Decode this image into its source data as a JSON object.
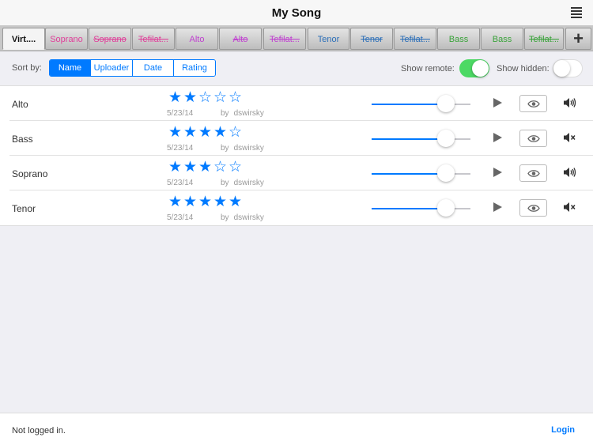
{
  "header": {
    "title": "My Song",
    "menu_icon": "list-menu-icon"
  },
  "tabs": [
    {
      "label": "Virt....",
      "color": "#111111",
      "struck": false,
      "active": true
    },
    {
      "label": "Soprano",
      "color": "#e0409a",
      "struck": false,
      "active": false
    },
    {
      "label": "Soprano",
      "color": "#e0409a",
      "struck": true,
      "active": false
    },
    {
      "label": "Tefilat...",
      "color": "#e0409a",
      "struck": true,
      "active": false
    },
    {
      "label": "Alto",
      "color": "#c040d0",
      "struck": false,
      "active": false
    },
    {
      "label": "Alto",
      "color": "#c040d0",
      "struck": true,
      "active": false
    },
    {
      "label": "Tefilat...",
      "color": "#c040d0",
      "struck": true,
      "active": false
    },
    {
      "label": "Tenor",
      "color": "#2c6fb8",
      "struck": false,
      "active": false
    },
    {
      "label": "Tenor",
      "color": "#2c6fb8",
      "struck": true,
      "active": false
    },
    {
      "label": "Tefilat...",
      "color": "#2c6fb8",
      "struck": true,
      "active": false
    },
    {
      "label": "Bass",
      "color": "#3aa33a",
      "struck": false,
      "active": false
    },
    {
      "label": "Bass",
      "color": "#3aa33a",
      "struck": false,
      "active": false
    },
    {
      "label": "Tefilat...",
      "color": "#3aa33a",
      "struck": true,
      "active": false
    }
  ],
  "add_tab_label": "+",
  "controls": {
    "sort_label": "Sort by:",
    "sort_options": [
      "Name",
      "Uploader",
      "Date",
      "Rating"
    ],
    "sort_selected": "Name",
    "show_remote_label": "Show remote:",
    "show_remote": true,
    "show_hidden_label": "Show hidden:",
    "show_hidden": false
  },
  "tracks": [
    {
      "name": "Alto",
      "rating": 2,
      "date": "5/23/14",
      "by_label": "by",
      "uploader": "dswirsky",
      "volume": 0.75,
      "muted": false
    },
    {
      "name": "Bass",
      "rating": 4,
      "date": "5/23/14",
      "by_label": "by",
      "uploader": "dswirsky",
      "volume": 0.75,
      "muted": true
    },
    {
      "name": "Soprano",
      "rating": 3,
      "date": "5/23/14",
      "by_label": "by",
      "uploader": "dswirsky",
      "volume": 0.75,
      "muted": false
    },
    {
      "name": "Tenor",
      "rating": 5,
      "date": "5/23/14",
      "by_label": "by",
      "uploader": "dswirsky",
      "volume": 0.75,
      "muted": true
    }
  ],
  "rating_max": 5,
  "footer": {
    "status": "Not logged in.",
    "login_label": "Login"
  },
  "colors": {
    "accent": "#007aff",
    "switch_on": "#4cd964"
  }
}
